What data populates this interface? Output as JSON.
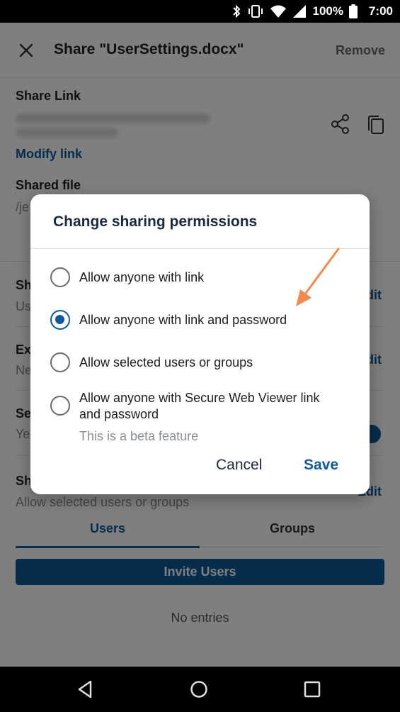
{
  "status_bar": {
    "battery_text": "100%",
    "time": "7:00"
  },
  "app_bar": {
    "title": "Share \"UserSettings.docx\"",
    "remove_label": "Remove"
  },
  "page": {
    "share_link_label": "Share Link",
    "modify_link_label": "Modify link",
    "shared_file_label": "Shared file",
    "shared_file_value": "/je",
    "section2_label": "Sh",
    "section2_value": "Us",
    "section3_label": "Ex",
    "section3_value": "Ne",
    "section4_label": "Se",
    "section4_value": "Ye",
    "section5_label": "Sh",
    "section5_value": "Allow selected users or groups",
    "edit_label": "dit",
    "edit_label_last": "Edit",
    "tabs": [
      "Users",
      "Groups"
    ],
    "invite_button": "Invite Users",
    "no_entries": "No entries"
  },
  "dialog": {
    "title": "Change sharing permissions",
    "options": [
      {
        "label": "Allow anyone with link",
        "selected": false
      },
      {
        "label": "Allow anyone with link and password",
        "selected": true
      },
      {
        "label": "Allow selected users or groups",
        "selected": false
      },
      {
        "label": "Allow anyone with Secure Web Viewer link and password",
        "selected": false
      }
    ],
    "beta_note": "This is a beta feature",
    "cancel_label": "Cancel",
    "save_label": "Save"
  },
  "colors": {
    "accent": "#0e5a9b",
    "arrow": "#f28a4b",
    "scrim": "rgba(0,0,0,0.5)"
  },
  "icons": [
    "bluetooth-icon",
    "vibrate-icon",
    "wifi-icon",
    "signal-icon",
    "battery-icon",
    "close-icon",
    "share-icon",
    "copy-icon",
    "nav-back-icon",
    "nav-home-icon",
    "nav-recents-icon"
  ]
}
